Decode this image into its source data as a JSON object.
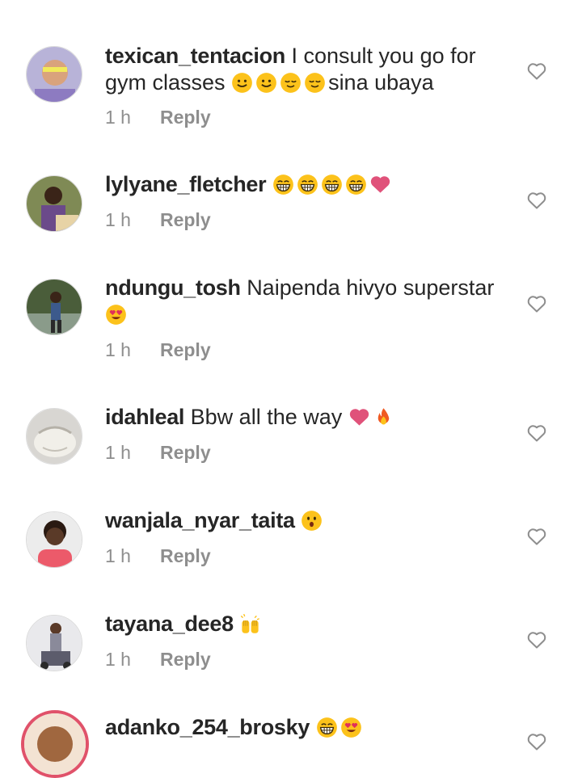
{
  "comments": [
    {
      "username": "texican_tentacion",
      "text_before": "I consult you go for gym classes",
      "emojis": [
        "smile",
        "smile",
        "relieved",
        "relieved"
      ],
      "text_after": "sina ubaya",
      "time": "1 h",
      "reply_label": "Reply"
    },
    {
      "username": "lylyane_fletcher",
      "text_before": "",
      "emojis": [
        "grin",
        "grin",
        "grin",
        "grin",
        "heart"
      ],
      "text_after": "",
      "time": "1 h",
      "reply_label": "Reply"
    },
    {
      "username": "ndungu_tosh",
      "text_before": "Naipenda hivyo superstar",
      "emojis": [
        "heart-eyes"
      ],
      "text_after": "",
      "time": "1 h",
      "reply_label": "Reply"
    },
    {
      "username": "idahleal",
      "text_before": "Bbw all the way",
      "emojis": [
        "heart",
        "fire"
      ],
      "text_after": "",
      "time": "1 h",
      "reply_label": "Reply"
    },
    {
      "username": "wanjala_nyar_taita",
      "text_before": "",
      "emojis": [
        "hushed"
      ],
      "text_after": "",
      "time": "1 h",
      "reply_label": "Reply"
    },
    {
      "username": "tayana_dee8",
      "text_before": "",
      "emojis": [
        "raised-hands"
      ],
      "text_after": "",
      "time": "1 h",
      "reply_label": "Reply"
    },
    {
      "username": "adanko_254_brosky",
      "text_before": "",
      "emojis": [
        "grin",
        "heart-eyes"
      ],
      "text_after": "",
      "time": "",
      "reply_label": ""
    }
  ],
  "colors": {
    "text": "#262626",
    "meta": "#8e8e8e",
    "emoji_yellow": "#fcc21b",
    "heart_pink": "#e0527a",
    "story_ring": "#e0526a"
  },
  "icons": {
    "like": "heart-outline-icon"
  }
}
